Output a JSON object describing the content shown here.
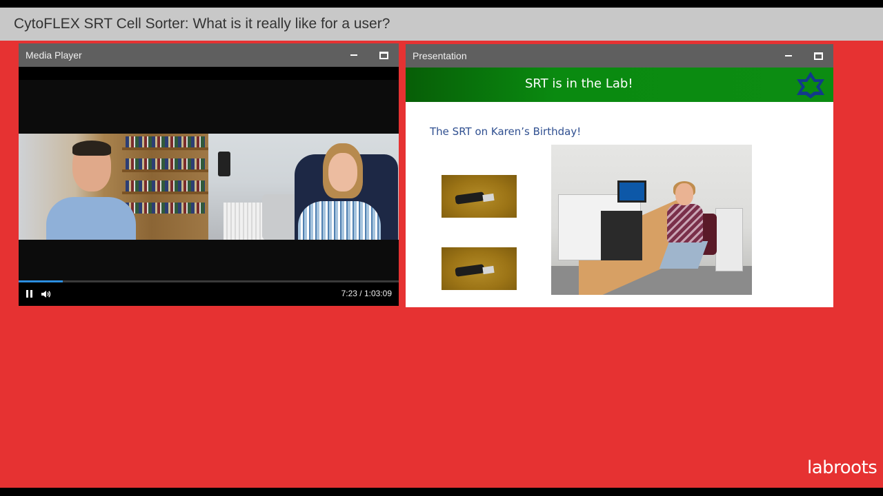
{
  "page": {
    "title": "CytoFLEX SRT Cell Sorter: What is it really like for a user?",
    "brand": "labroots",
    "colors": {
      "background": "#e63232",
      "titlebar": "#c8c8c8",
      "panel_header": "#5f5f5f",
      "slide_header": "#0a8a10",
      "progress": "#2b8ee0"
    }
  },
  "media_player": {
    "label": "Media Player",
    "time_display": "7:23 / 1:03:09",
    "progress_fraction": 0.117,
    "controls": {
      "pause_icon": "pause-icon",
      "volume_icon": "volume-icon"
    },
    "window_icons": [
      "minimize-icon",
      "maximize-icon"
    ]
  },
  "presentation": {
    "label": "Presentation",
    "slide": {
      "title": "SRT is in the Lab!",
      "subtitle": "The SRT on Karen’s Birthday!",
      "logo_icon": "star-logo-icon"
    },
    "window_icons": [
      "minimize-icon",
      "maximize-icon"
    ]
  }
}
